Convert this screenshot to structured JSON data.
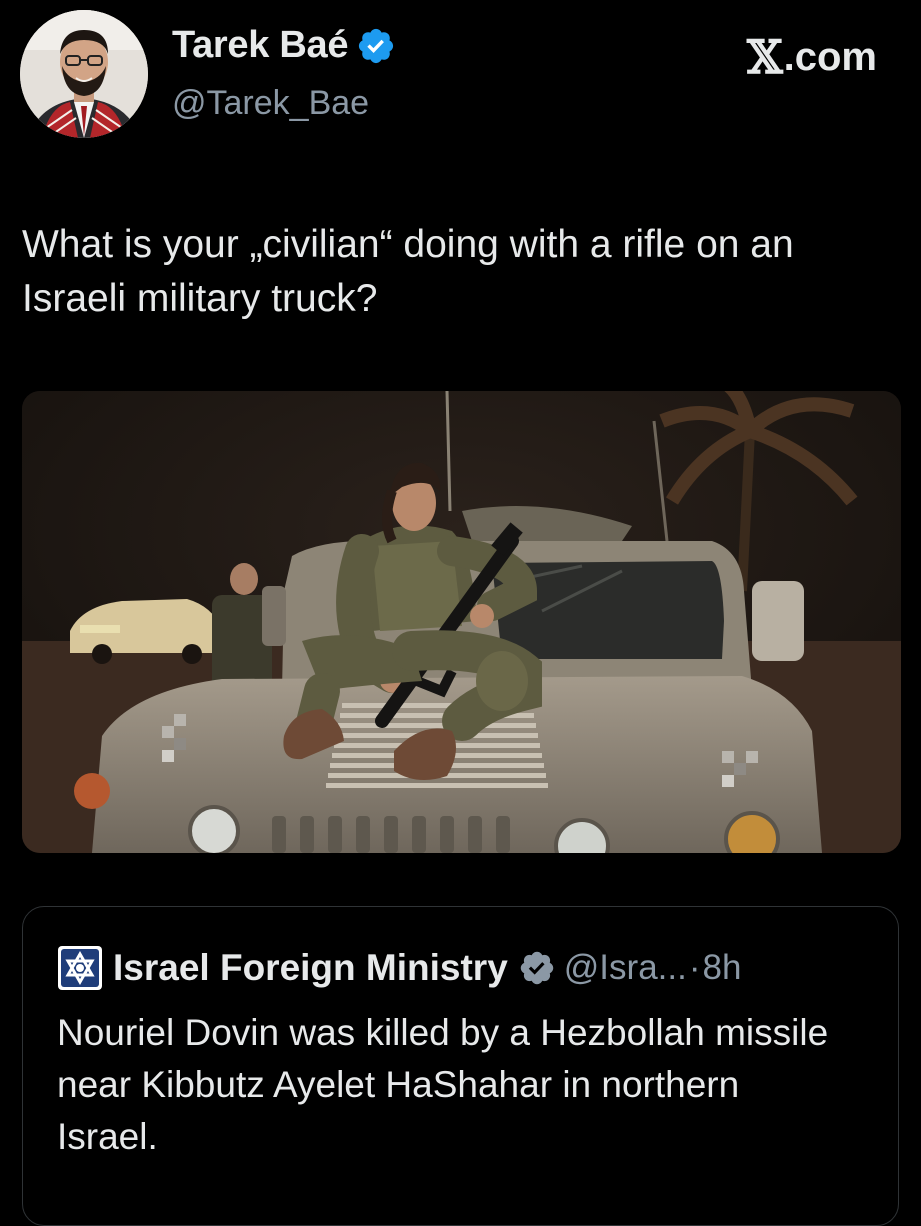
{
  "author": {
    "display_name": "Tarek Baé",
    "handle": "@Tarek_Bae",
    "avatar": "profile-photo"
  },
  "branding": {
    "site_x": "𝕏",
    "site_rest": ".com"
  },
  "tweet": {
    "text": "What is your „civilian“ doing with a rifle on an Israeli military truck?",
    "media": "photo-soldier-on-military-vehicle"
  },
  "quoted_tweet": {
    "display_name": "Israel Foreign Ministry",
    "handle": "@Isra...",
    "separator": "·",
    "time": "8h",
    "text": "Nouriel Dovin was killed by a Hezbollah missile near Kibbutz Ayelet HaShahar in northern Israel."
  },
  "colors": {
    "background": "#000000",
    "text_primary": "#e7e9ea",
    "text_secondary": "#8b98a5",
    "verified_blue": "#1d9bf0",
    "border": "#2f3336"
  }
}
